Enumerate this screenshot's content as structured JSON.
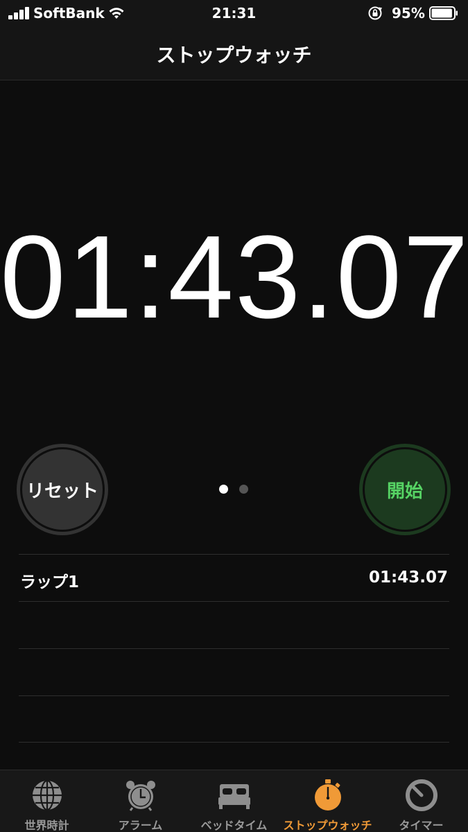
{
  "status_bar": {
    "carrier": "SoftBank",
    "time": "21:31",
    "battery_percent": "95%",
    "battery_level": 0.95
  },
  "nav": {
    "title": "ストップウォッチ"
  },
  "stopwatch": {
    "time": "01:43.07",
    "reset_label": "リセット",
    "start_label": "開始",
    "page_indicator": {
      "count": 2,
      "current": 1
    }
  },
  "laps": [
    {
      "label": "ラップ1",
      "time": "01:43.07"
    }
  ],
  "tabs": [
    {
      "label": "世界時計",
      "icon": "globe-icon",
      "active": false
    },
    {
      "label": "アラーム",
      "icon": "alarm-clock-icon",
      "active": false
    },
    {
      "label": "ベッドタイム",
      "icon": "bed-icon",
      "active": false
    },
    {
      "label": "ストップウォッチ",
      "icon": "stopwatch-icon",
      "active": true
    },
    {
      "label": "タイマー",
      "icon": "timer-icon",
      "active": false
    }
  ],
  "colors": {
    "background": "#0d0d0d",
    "accent": "#f09a37",
    "start_green": "#56d364",
    "start_bg": "#1c3a1f",
    "reset_bg": "#333333",
    "inactive_tab": "#9a9a9a"
  }
}
